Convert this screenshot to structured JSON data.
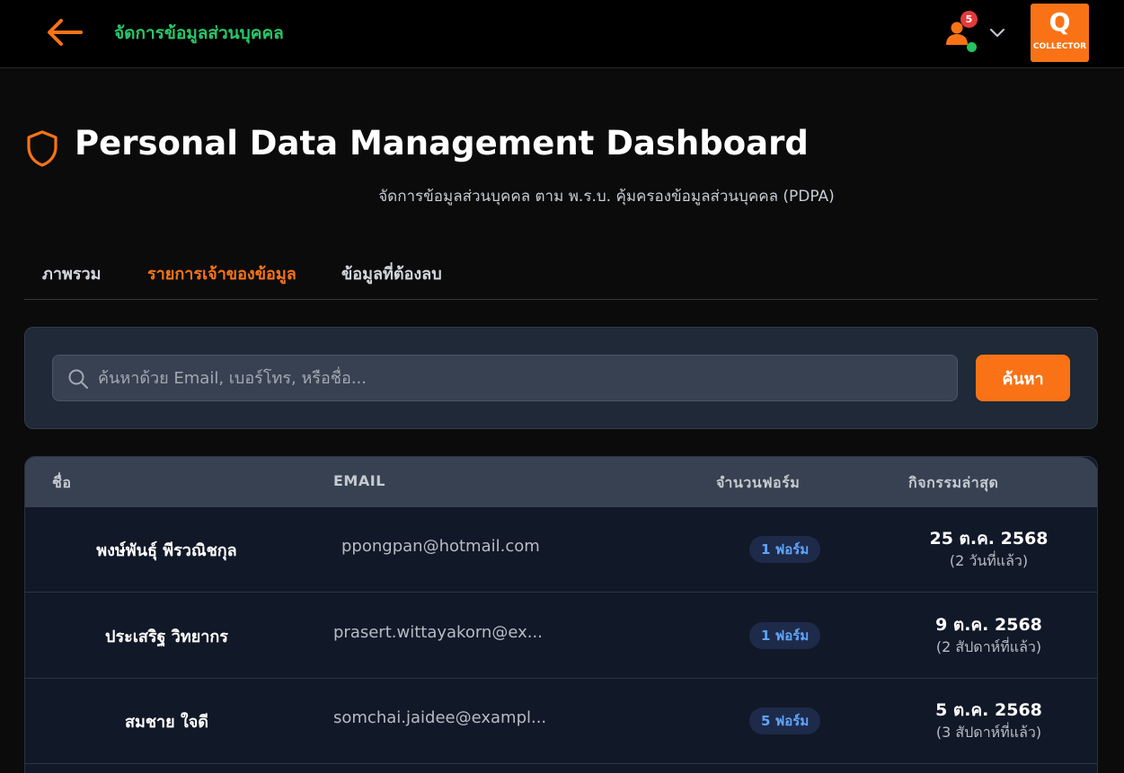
{
  "topbar": {
    "title": "จัดการข้อมูลส่วนบุคคล",
    "notification_count": "5",
    "logo_letter": "Q",
    "logo_text": "COLLECTOR"
  },
  "header": {
    "title": "Personal Data Management Dashboard",
    "subtitle": "จัดการข้อมูลส่วนบุคคล ตาม พ.ร.บ. คุ้มครองข้อมูลส่วนบุคคล (PDPA)"
  },
  "tabs": [
    {
      "label": "ภาพรวม",
      "active": false
    },
    {
      "label": "รายการเจ้าของข้อมูล",
      "active": true
    },
    {
      "label": "ข้อมูลที่ต้องลบ",
      "active": false
    }
  ],
  "search": {
    "placeholder": "ค้นหาด้วย Email, เบอร์โทร, หรือชื่อ...",
    "value": "",
    "button_label": "ค้นหา"
  },
  "table": {
    "columns": [
      "ชื่อ",
      "EMAIL",
      "จำนวนฟอร์ม",
      "กิจกรรมล่าสุด"
    ],
    "rows": [
      {
        "name": "พงษ์พันธุ์ พีรวณิชกุล",
        "email": "ppongpan@hotmail.com",
        "forms": "1 ฟอร์ม",
        "date": "25 ต.ค. 2568",
        "ago": "(2 วันที่แล้ว)"
      },
      {
        "name": "ประเสริฐ วิทยากร",
        "email": "prasert.wittayakorn@ex...",
        "forms": "1 ฟอร์ม",
        "date": "9 ต.ค. 2568",
        "ago": "(2 สัปดาห์ที่แล้ว)"
      },
      {
        "name": "สมชาย ใจดี",
        "email": "somchai.jaidee@exampl...",
        "forms": "5 ฟอร์ม",
        "date": "5 ต.ค. 2568",
        "ago": "(3 สัปดาห์ที่แล้ว)"
      }
    ]
  },
  "colors": {
    "accent": "#f97316",
    "title_green": "#29c66a",
    "badge_text": "#60a5fa",
    "online": "#22c55e",
    "notification": "#e23b3b"
  },
  "icons": {
    "back": "arrow-left-icon",
    "user": "user-icon",
    "chevron": "chevron-down-icon",
    "shield": "shield-icon",
    "search": "search-icon"
  }
}
